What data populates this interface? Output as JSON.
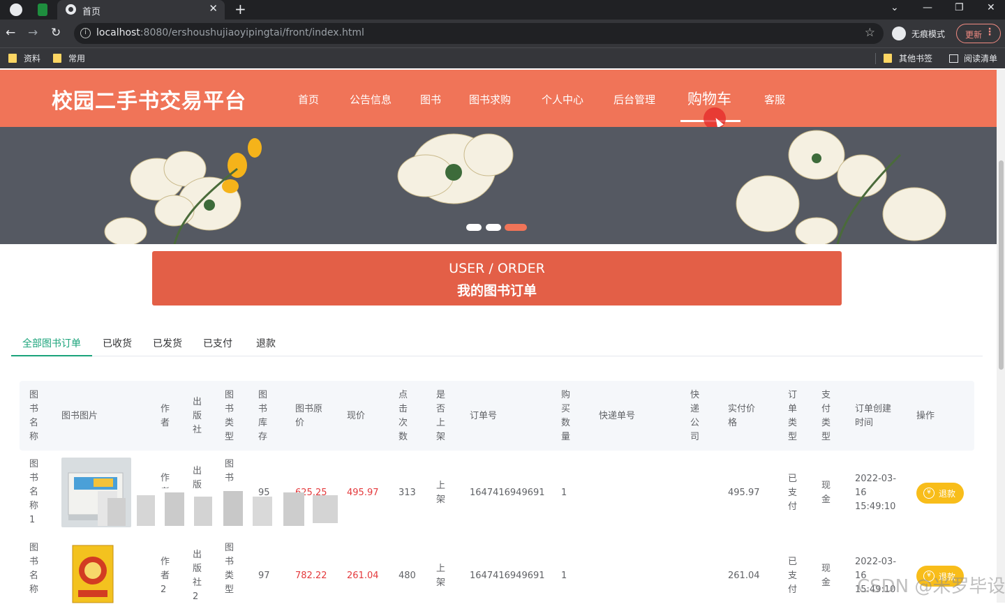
{
  "browser": {
    "tab_title": "首页",
    "url_host": "localhost",
    "url_path": ":8080/ershoushujiaoyipingtai/front/index.html",
    "incognito_label": "无痕模式",
    "update_label": "更新",
    "bookmarks": [
      "资料",
      "常用"
    ],
    "bookmarks_right": [
      "其他书签",
      "阅读清单"
    ]
  },
  "site": {
    "title": "校园二手书交易平台",
    "nav": [
      "首页",
      "公告信息",
      "图书",
      "图书求购",
      "个人中心",
      "后台管理",
      "购物车",
      "客服"
    ],
    "active_nav": "购物车"
  },
  "order_banner": {
    "en": "USER / ORDER",
    "cn": "我的图书订单"
  },
  "filter_tabs": [
    "全部图书订单",
    "已收货",
    "已发货",
    "已支付",
    "退款"
  ],
  "table": {
    "headers": {
      "name": "图书名称",
      "image": "图书图片",
      "author": "作者",
      "publisher": "出版社",
      "type": "图书类型",
      "stock": "图书库存",
      "orig_price": "图书原价",
      "price": "现价",
      "clicks": "点击次数",
      "listed": "是否上架",
      "order_no": "订单号",
      "qty": "购买数量",
      "express_no": "快递单号",
      "express_co": "快递公司",
      "paid": "实付价格",
      "order_type": "订单类型",
      "pay_type": "支付类型",
      "created": "订单创建时间",
      "action": "操作"
    },
    "rows": [
      {
        "name": "图书名称1",
        "author": "作者",
        "publisher": "出版",
        "type": "图书",
        "stock": "95",
        "orig_price": "625.25",
        "price": "495.97",
        "clicks": "313",
        "listed": "上架",
        "order_no": "1647416949691",
        "qty": "1",
        "express_no": "",
        "express_co": "",
        "paid": "495.97",
        "order_type": "已支付",
        "pay_type": "现金",
        "created_date": "2022-03-",
        "created_day": "16",
        "created_time": "15:49:10",
        "action": "退款"
      },
      {
        "name": "图书名称",
        "author": "作者2",
        "publisher": "出版社2",
        "type": "图书类型",
        "stock": "97",
        "orig_price": "782.22",
        "price": "261.04",
        "clicks": "480",
        "listed": "上架",
        "order_no": "1647416949691",
        "qty": "1",
        "express_no": "",
        "express_co": "",
        "paid": "261.04",
        "order_type": "已支付",
        "pay_type": "现金",
        "created_date": "2022-03-",
        "created_day": "16",
        "created_time": "15:49:10",
        "action": "退款"
      }
    ]
  },
  "watermark": "CSDN @米罗毕设",
  "colors": {
    "header_bg": "#f07458",
    "order_banner_bg": "#e35f47",
    "active_tab": "#1aa37a",
    "price_red": "#e4393c",
    "refund_button": "#f8bd1a"
  },
  "icons": [
    "globe-icon",
    "sheets-icon",
    "close-icon",
    "plus-icon",
    "back-icon",
    "forward-icon",
    "reload-icon",
    "info-icon",
    "star-icon",
    "incognito-icon",
    "folder-icon",
    "reading-list-icon",
    "yen-icon"
  ]
}
